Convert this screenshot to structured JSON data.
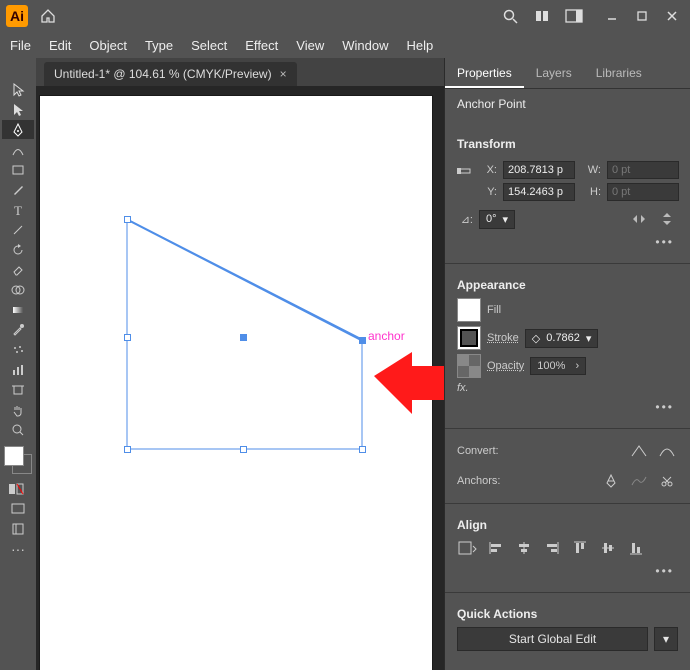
{
  "titlebar": {
    "logo": "Ai"
  },
  "menubar": [
    "File",
    "Edit",
    "Object",
    "Type",
    "Select",
    "Effect",
    "View",
    "Window",
    "Help"
  ],
  "document": {
    "tab_title": "Untitled-1* @ 104.61 % (CMYK/Preview)",
    "anchor_label": "anchor"
  },
  "panels": {
    "tabs": [
      "Properties",
      "Layers",
      "Libraries"
    ],
    "active_tab": "Properties",
    "context": "Anchor Point",
    "transform": {
      "title": "Transform",
      "x_label": "X:",
      "x": "208.7813 p",
      "y_label": "Y:",
      "y": "154.2463 p",
      "w_label": "W:",
      "w": "0 pt",
      "h_label": "H:",
      "h": "0 pt",
      "angle_label": "⊿:",
      "angle": "0°"
    },
    "appearance": {
      "title": "Appearance",
      "fill_label": "Fill",
      "stroke_label": "Stroke",
      "stroke_weight": "0.7862",
      "opacity_label": "Opacity",
      "opacity": "100%",
      "fx_label": "fx."
    },
    "convert": {
      "label": "Convert:"
    },
    "anchors": {
      "label": "Anchors:"
    },
    "align": {
      "label": "Align"
    },
    "quick_actions": {
      "title": "Quick Actions",
      "global_edit": "Start Global Edit"
    }
  }
}
